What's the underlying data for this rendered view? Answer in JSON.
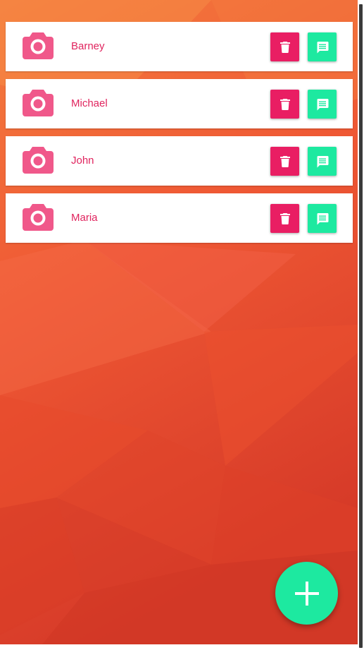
{
  "colors": {
    "accent_pink": "#e91e63",
    "avatar_pink": "#f0588a",
    "name_text": "#e0245e",
    "accent_teal": "#1de9a0",
    "background_top": "#f47d3e",
    "background_bottom": "#d63a28"
  },
  "contacts": [
    {
      "name": "Barney",
      "avatar_icon": "camera-icon",
      "delete_icon": "trash-icon",
      "message_icon": "message-icon"
    },
    {
      "name": "Michael",
      "avatar_icon": "camera-icon",
      "delete_icon": "trash-icon",
      "message_icon": "message-icon"
    },
    {
      "name": "John",
      "avatar_icon": "camera-icon",
      "delete_icon": "trash-icon",
      "message_icon": "message-icon"
    },
    {
      "name": "Maria",
      "avatar_icon": "camera-icon",
      "delete_icon": "trash-icon",
      "message_icon": "message-icon"
    }
  ],
  "fab": {
    "icon": "plus-icon"
  }
}
